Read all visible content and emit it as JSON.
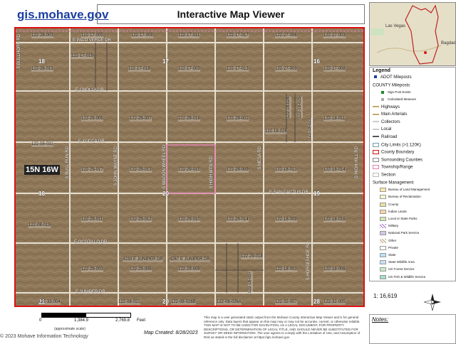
{
  "header": {
    "site_link": "gis.mohave.gov",
    "title": "Interactive Map Viewer"
  },
  "map": {
    "township": "15N 16W",
    "sections": [
      "18",
      "17",
      "16",
      "18",
      "20",
      "19",
      "21",
      "20",
      "28"
    ],
    "parcels": [
      "122-28-003",
      "122-17-005",
      "122-17-008",
      "122-17-011",
      "122-17-017",
      "122-27-006",
      "122-27-003",
      "122-17-019",
      "122-28-013",
      "122-17-018",
      "122-17-003",
      "122-17-013",
      "122-27-009",
      "122-27-008",
      "122-29-005",
      "122-29-007",
      "122-29-016",
      "122-29-002",
      "122-18-026",
      "122-18-011",
      "122-08-031",
      "122-29-017",
      "122-29-013",
      "122-29-015",
      "122-29-009",
      "122-18-013",
      "122-18-014",
      "122-29-011",
      "122-29-012",
      "122-29-010",
      "122-29-014",
      "122-18-009",
      "122-18-016",
      "122-08-019",
      "122-29-003",
      "122-29-006",
      "122-29-008",
      "122-29-018",
      "122-18-003",
      "122-18-006",
      "122-33-004",
      "122-08-021",
      "122-08-026B",
      "122-08-026A",
      "122-32-007",
      "122-32-005",
      "122-18-024",
      "122-18-025",
      "122-18-023",
      "122-18-007"
    ],
    "roads": {
      "palo_verde": "E PALO VERDE DR",
      "cholla": "E CHOLLA DR",
      "yucca": "E YUCCA DR",
      "cactus": "E SAN CACTUS DR",
      "ocotillo": "E OCOTILLO DR",
      "juniper": "E JUNIPER DR",
      "juniper_address_1": "4233 E JUNIPER DR",
      "juniper_address_2": "4267 E JUNIPER DR",
      "bull_run": "S BULL RUN RD",
      "john_wayne": "S JOHN WAYNE RD",
      "wagon_wheel": "S WAGON WHEEL RD",
      "high_mtn": "S HIGH MTN RD",
      "mesa_rd": "S MESA RD",
      "horseshoe": "S HORSESHOE RD",
      "high_rd": "S HIGH HILL RD",
      "bottom": "S BULLHORN RD"
    }
  },
  "locator": {
    "city1": "Las Vegas",
    "city2": "Bagdad"
  },
  "legend": {
    "title": "Legend",
    "items": [
      {
        "label": "ADOT Mileposts",
        "kind": "point",
        "color": "#1a3fa0"
      },
      {
        "label": "COUNTY Mileposts",
        "kind": "none",
        "color": ""
      },
      {
        "label": "Sign Post Exists",
        "kind": "point",
        "color": "#1d8a2a",
        "small": true
      },
      {
        "label": "Calculated Measure",
        "kind": "point",
        "color": "#aaaaaa",
        "small": true
      },
      {
        "label": "Highways",
        "kind": "line",
        "color": "#c8a86a"
      },
      {
        "label": "Main Arterials",
        "kind": "line",
        "color": "#c8a86a"
      },
      {
        "label": "Collectors",
        "kind": "line",
        "color": "#cccccc"
      },
      {
        "label": "Local",
        "kind": "line",
        "color": "#cccccc"
      },
      {
        "label": "Railroad",
        "kind": "line",
        "color": "#555555"
      },
      {
        "label": "City Limits (>1:120K)",
        "kind": "box",
        "color": "#6fa0b0"
      },
      {
        "label": "County Boundary",
        "kind": "box",
        "color": "#d11111"
      },
      {
        "label": "Surrounding Counties",
        "kind": "box",
        "color": "#888888"
      },
      {
        "label": "Township/Range",
        "kind": "box",
        "color": "#e080b0"
      },
      {
        "label": "Section",
        "kind": "box",
        "color": "#bbbbbb"
      },
      {
        "label": "Surface Management",
        "kind": "none",
        "color": ""
      },
      {
        "label": "Bureau of Land Management",
        "kind": "fill",
        "color": "#fde9a4",
        "small": true
      },
      {
        "label": "Bureau of Reclamation",
        "kind": "fill",
        "color": "#fff8d0",
        "small": true
      },
      {
        "label": "County",
        "kind": "fill",
        "color": "#e8e0a0",
        "small": true
      },
      {
        "label": "Indian Lands",
        "kind": "fill",
        "color": "#fbd2a8",
        "small": true
      },
      {
        "label": "Local or State Parks",
        "kind": "fill",
        "color": "#cfe8b0",
        "small": true
      },
      {
        "label": "Military",
        "kind": "hatch",
        "color": "#a070c0",
        "small": true
      },
      {
        "label": "National Park Service",
        "kind": "fill",
        "color": "#d0c8e8",
        "small": true
      },
      {
        "label": "Other",
        "kind": "hatch",
        "color": "#b89a70",
        "small": true
      },
      {
        "label": "Private",
        "kind": "fill",
        "color": "#ffffff",
        "small": true
      },
      {
        "label": "State",
        "kind": "fill",
        "color": "#b8e4f4",
        "small": true
      },
      {
        "label": "State Wildlife Area",
        "kind": "fill",
        "color": "#c8e0f8",
        "small": true
      },
      {
        "label": "US Forest Service",
        "kind": "fill",
        "color": "#c8ecc8",
        "small": true
      },
      {
        "label": "US Fish & Wildlife Service",
        "kind": "fill",
        "color": "#a8dcd0",
        "small": true
      }
    ]
  },
  "scale": {
    "ratio": "1: 16,619",
    "ticks": [
      "0",
      "1,384.9",
      "2,769.8"
    ],
    "units": "Feet",
    "approx": "(approximate scale)"
  },
  "footer": {
    "created": "Map Created: 8/28/2023",
    "disclaimer": "This map is a user generated static output from the Mohave County Interactive Map Viewer and is for general reference only. Data layers that appear on this map may or may not be accurate, current, or otherwise reliable. THIS MAP IS NOT TO BE USED FOR NAVIGATION, AS A LEGAL DOCUMENT, FOR PROPERTY DESCRIPTIONS, OR DETERMINATION OF LEGAL TITLE, AND SHOULD NEVER BE SUBSTITUTED FOR SURVEY OR DEED INFORMATION. The user agrees to comply with the Limitation of Use, and Assumption of Risk as stated in the full disclaimer at https://gis.mohave.gov",
    "notes_label": "Notes:",
    "credit": "© 2023 Mohave Information Technology"
  },
  "colors": {
    "county_boundary": "#d11111",
    "highlight_parcel": "#e080b0",
    "link": "#1a3fa0"
  }
}
